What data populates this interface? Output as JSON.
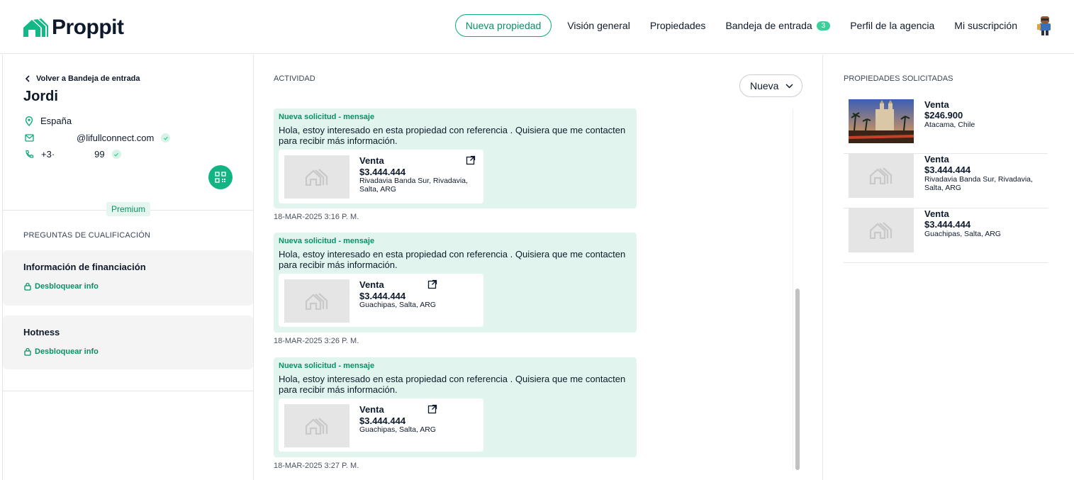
{
  "header": {
    "logo_text": "Proppit",
    "new_property_label": "Nueva propiedad",
    "nav": {
      "overview": "Visión general",
      "properties": "Propiedades",
      "inbox": "Bandeja de entrada",
      "inbox_count": "3",
      "agency_profile": "Perfil de la agencia",
      "subscription": "Mi suscripción"
    }
  },
  "contact": {
    "back_label": "Volver a Bandeja de entrada",
    "name": "Jordi",
    "country": "España",
    "email": "@lifullconnect.com",
    "phone_prefix": "+3·",
    "phone_suffix": "99",
    "plan_badge": "Premium"
  },
  "qualification": {
    "title": "PREGUNTAS DE CUALIFICACIÓN",
    "cards": [
      {
        "title": "Información de financiación",
        "unlock_label": "Desbloquear info"
      },
      {
        "title": "Hotness",
        "unlock_label": "Desbloquear info"
      }
    ]
  },
  "activity": {
    "title": "ACTIVIDAD",
    "sort_label": "Nueva",
    "messages": [
      {
        "heading": "Nueva solicitud - mensaje",
        "body": "Hola, estoy interesado en esta propiedad con referencia . Quisiera que me contacten para recibir más información.",
        "property": {
          "type": "Venta",
          "price": "$3.444.444",
          "location": "Rivadavia Banda Sur, Rivadavia, Salta, ARG"
        },
        "timestamp": "18-MAR-2025 3:16 P. M."
      },
      {
        "heading": "Nueva solicitud - mensaje",
        "body": "Hola, estoy interesado en esta propiedad con referencia . Quisiera que me contacten para recibir más información.",
        "property": {
          "type": "Venta",
          "price": "$3.444.444",
          "location": "Guachipas, Salta, ARG"
        },
        "timestamp": "18-MAR-2025 3:26 P. M."
      },
      {
        "heading": "Nueva solicitud - mensaje",
        "body": "Hola, estoy interesado en esta propiedad con referencia . Quisiera que me contacten para recibir más información.",
        "property": {
          "type": "Venta",
          "price": "$3.444.444",
          "location": "Guachipas, Salta, ARG"
        },
        "timestamp": "18-MAR-2025 3:27 P. M."
      }
    ]
  },
  "requested": {
    "title": "PROPIEDADES SOLICITADAS",
    "items": [
      {
        "type": "Venta",
        "price": "$246.900",
        "location": "Atacama, Chile"
      },
      {
        "type": "Venta",
        "price": "$3.444.444",
        "location": "Rivadavia Banda Sur, Rivadavia, Salta, ARG"
      },
      {
        "type": "Venta",
        "price": "$3.444.444",
        "location": "Guachipas, Salta, ARG"
      }
    ]
  },
  "colors": {
    "brand_green": "#0a8f67",
    "message_bg": "#e1f5ee",
    "badge_green": "#3dcf9a"
  }
}
